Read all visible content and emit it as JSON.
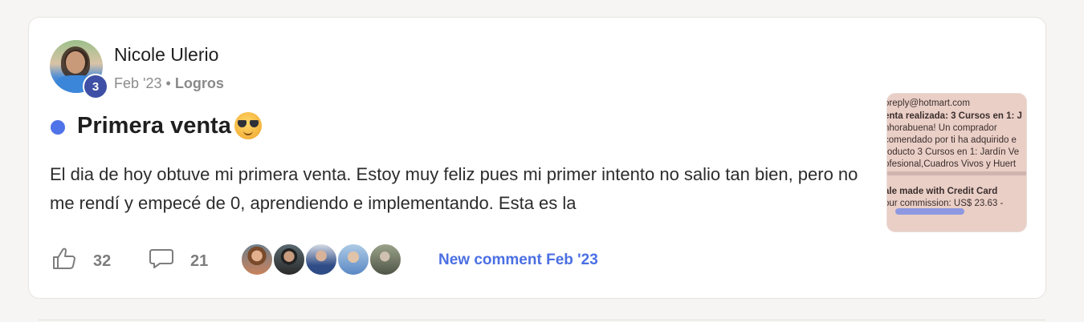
{
  "post": {
    "author": "Nicole Ulerio",
    "level": "3",
    "date": "Feb '23",
    "separator": "•",
    "category": "Logros",
    "title": "Primera venta",
    "excerpt": "El dia de hoy obtuve mi primera venta. Estoy muy feliz pues mi primer intento no salio tan bien, pero no me rendí y empecé de 0, aprendiendo e implementando. Esta es la",
    "likes": "32",
    "comments": "21",
    "new_comment": "New comment Feb '23",
    "icons": {
      "like": "thumbs-up-icon",
      "comment": "speech-bubble-icon",
      "title_emoji": "sunglasses-emoji-icon",
      "unread": "unread-dot"
    },
    "colors": {
      "accent": "#4b6fe3",
      "unread_dot": "#4f73e8",
      "level_badge": "#3f4fa5"
    }
  },
  "thumbnail": {
    "lines": [
      "oreply@hotmart.com",
      "enta realizada: 3 Cursos en 1: J",
      "nhorabuena! Un comprador",
      "comendado por ti ha adquirido e",
      "roducto 3 Cursos en 1: Jardín Ve",
      "ofesional,Cuadros Vivos y Huert",
      "ale made with Credit Card",
      "our commission: US$ 23.63 -"
    ]
  },
  "commenters": [
    {
      "name": "commenter-avatar-1",
      "color": "#b9744f"
    },
    {
      "name": "commenter-avatar-2",
      "color": "#3d3d3d"
    },
    {
      "name": "commenter-avatar-3",
      "color": "#9aa6bd"
    },
    {
      "name": "commenter-avatar-4",
      "color": "#c7d7e6"
    },
    {
      "name": "commenter-avatar-5",
      "color": "#6b6a5c"
    }
  ]
}
